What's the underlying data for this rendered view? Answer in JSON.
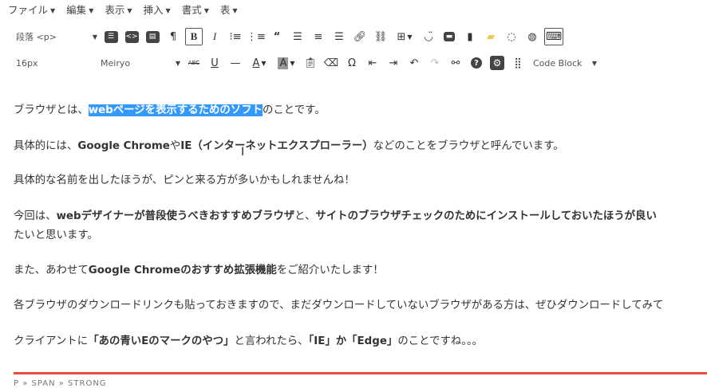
{
  "menus": [
    {
      "label": "ファイル"
    },
    {
      "label": "編集"
    },
    {
      "label": "表示"
    },
    {
      "label": "挿入"
    },
    {
      "label": "書式"
    },
    {
      "label": "表"
    }
  ],
  "toolbar": {
    "format_select": "段落 <p>",
    "font_size": "16px",
    "font_family": "Meiryo",
    "code_block": "Code Block"
  },
  "content": {
    "p1": {
      "pre": "ブラウザとは、",
      "highlight": "webページを表示するためのソフト",
      "post": "のことです。"
    },
    "p2": {
      "pre": "具体的には、",
      "b1": "Google Chrome",
      "mid": "や",
      "b2": "IE（インターネットエクスプローラー）",
      "post": "などのことをブラウザと呼んでいます。"
    },
    "p3": {
      "text": "具体的な名前を出したほうが、ピンと来る方が多いかもしれませんね！"
    },
    "p4": {
      "pre": "今回は、",
      "b1": "webデザイナーが普段使うべきおすすめブラウザ",
      "mid": "と、",
      "b2": "サイトのブラウザチェックのためにインストールしておいたほうが良い"
    },
    "p4b": {
      "text": "たいと思います。"
    },
    "p5": {
      "pre": "また、あわせて",
      "b1": "Google Chromeのおすすめ拡張機能",
      "post": "をご紹介いたします！"
    },
    "p6": {
      "text": "各ブラウザのダウンロードリンクも貼っておきますので、まだダウンロードしていないブラウザがある方は、ぜひダウンロードしてみて"
    },
    "p7": {
      "pre": "クライアントに",
      "b1": "「あの青いEのマークのやつ」",
      "mid": "と言われたら、",
      "b2": "「IE」か「Edge」",
      "post": "のことですね。。。"
    }
  },
  "statusbar": {
    "path": "P » SPAN » STRONG"
  }
}
